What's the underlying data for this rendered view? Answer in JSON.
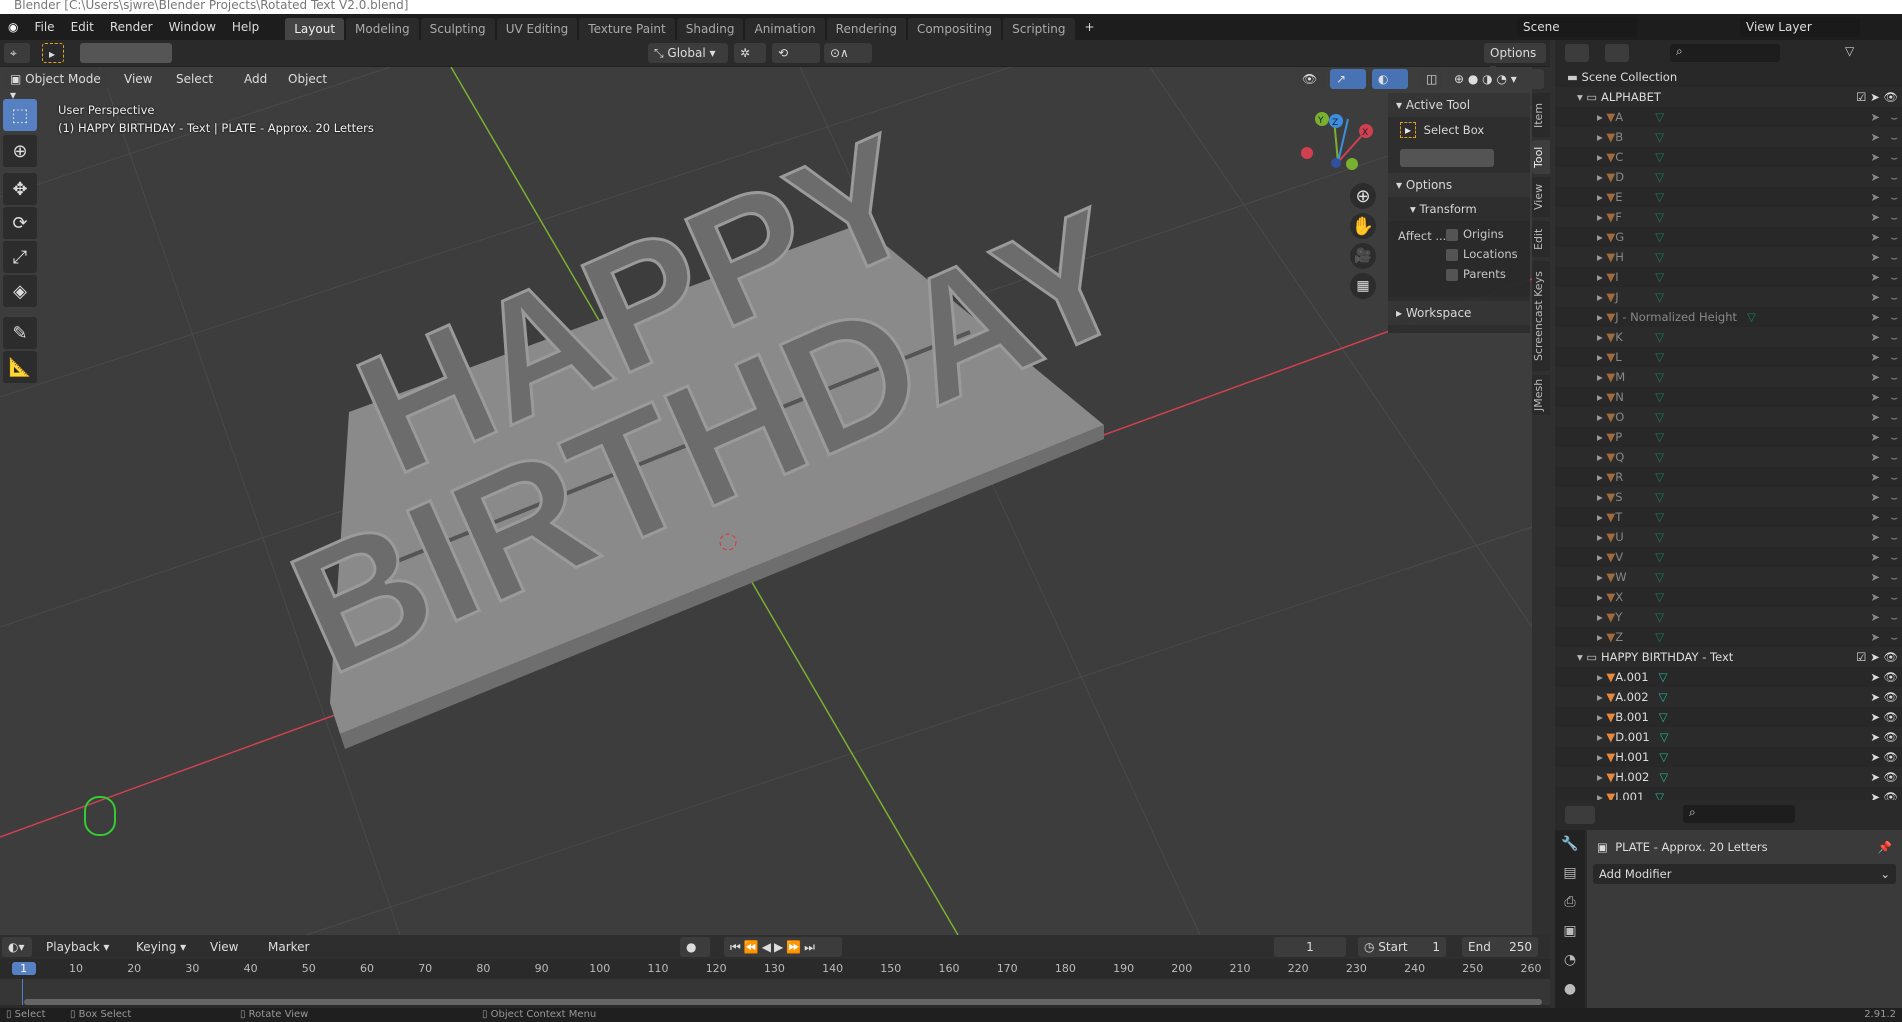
{
  "window": {
    "title": "Blender [C:\\Users\\sjwre\\Blender Projects\\Rotated Text V2.0.blend]"
  },
  "menu": [
    "File",
    "Edit",
    "Render",
    "Window",
    "Help"
  ],
  "workspaces": [
    {
      "label": "Layout",
      "active": true
    },
    {
      "label": "Modeling"
    },
    {
      "label": "Sculpting"
    },
    {
      "label": "UV Editing"
    },
    {
      "label": "Texture Paint"
    },
    {
      "label": "Shading"
    },
    {
      "label": "Animation"
    },
    {
      "label": "Rendering"
    },
    {
      "label": "Compositing"
    },
    {
      "label": "Scripting"
    }
  ],
  "add_workspace": "+",
  "scene": {
    "name": "Scene",
    "view_layer": "View Layer"
  },
  "toolheader": {
    "orientation": "Global",
    "options": "Options"
  },
  "viewport_header": {
    "mode": "Object Mode",
    "menus": [
      "View",
      "Select",
      "Add",
      "Object"
    ]
  },
  "viewport": {
    "view_name": "User Perspective",
    "active": "(1) HAPPY BIRTHDAY - Text | PLATE - Approx. 20 Letters",
    "scene_text": [
      "HAPPY",
      "BIRTHDAY"
    ],
    "axis_colors": {
      "x": "#d04050",
      "y": "#7ab030",
      "z": "#3c8ee0"
    }
  },
  "gizmo": {
    "x": "X",
    "y": "Y",
    "z": "Z"
  },
  "npanel": {
    "active_tool_title": "Active Tool",
    "tool_name": "Select Box",
    "options_title": "Options",
    "transform_title": "Transform",
    "affect_label": "Affect ...",
    "checks": [
      {
        "label": "Origins",
        "checked": false
      },
      {
        "label": "Locations",
        "checked": false
      },
      {
        "label": "Parents",
        "checked": false
      }
    ],
    "workspace_title": "Workspace"
  },
  "side_tabs": [
    {
      "label": "Item"
    },
    {
      "label": "Tool",
      "active": true
    },
    {
      "label": "View"
    },
    {
      "label": "Edit"
    },
    {
      "label": "Screencast Keys"
    },
    {
      "label": "JMesh"
    }
  ],
  "outliner": {
    "root": "Scene Collection",
    "collections": [
      {
        "name": "ALPHABET",
        "objects": [
          "A",
          "B",
          "C",
          "D",
          "E",
          "F",
          "G",
          "H",
          "I",
          "J",
          "J - Normalized Height",
          "K",
          "L",
          "M",
          "N",
          "O",
          "P",
          "Q",
          "R",
          "S",
          "T",
          "U",
          "V",
          "W",
          "X",
          "Y",
          "Z"
        ],
        "visible": false
      },
      {
        "name": "HAPPY BIRTHDAY - Text",
        "objects": [
          "A.001",
          "A.002",
          "B.001",
          "D.001",
          "H.001",
          "H.002",
          "I.001"
        ],
        "visible": true
      }
    ]
  },
  "properties": {
    "object_name": "PLATE - Approx. 20 Letters",
    "add_modifier": "Add Modifier"
  },
  "timeline": {
    "menus": [
      "Playback",
      "Keying",
      "View",
      "Marker"
    ],
    "current_frame": "1",
    "start_label": "Start",
    "start": "1",
    "end_label": "End",
    "end": "250",
    "ticks": [
      1,
      10,
      20,
      30,
      40,
      50,
      60,
      70,
      80,
      90,
      100,
      110,
      120,
      130,
      140,
      150,
      160,
      170,
      180,
      190,
      200,
      210,
      220,
      230,
      240,
      250,
      260
    ]
  },
  "status": {
    "items": [
      "Select",
      "Box Select",
      "Rotate View",
      "Object Context Menu"
    ],
    "version": "2.91.2"
  }
}
